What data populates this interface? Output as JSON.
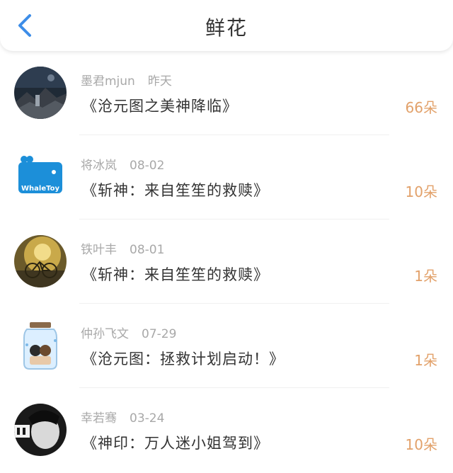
{
  "header": {
    "title": "鲜花"
  },
  "colors": {
    "accent_blue": "#3d8de8",
    "count_orange": "#e2a16a"
  },
  "items": [
    {
      "name": "墨君mjun",
      "date": "昨天",
      "book": "《沧元图之美神降临》",
      "count": "66朵",
      "avatar_icon": "night-scene-avatar"
    },
    {
      "name": "将冰岚",
      "date": "08-02",
      "book": "《斩神：来自笙笙的救赎》",
      "count": "10朵",
      "avatar_icon": "whaletoy-logo-avatar",
      "avatar_text": "WhaleToy"
    },
    {
      "name": "铁叶丰",
      "date": "08-01",
      "book": "《斩神：来自笙笙的救赎》",
      "count": "1朵",
      "avatar_icon": "bicycle-photo-avatar"
    },
    {
      "name": "仲孙飞文",
      "date": "07-29",
      "book": "《沧元图：拯救计划启动！》",
      "count": "1朵",
      "avatar_icon": "glass-jar-avatar"
    },
    {
      "name": "幸若骞",
      "date": "03-24",
      "book": "《神印：万人迷小姐驾到》",
      "count": "10朵",
      "avatar_icon": "bw-portrait-avatar"
    }
  ]
}
